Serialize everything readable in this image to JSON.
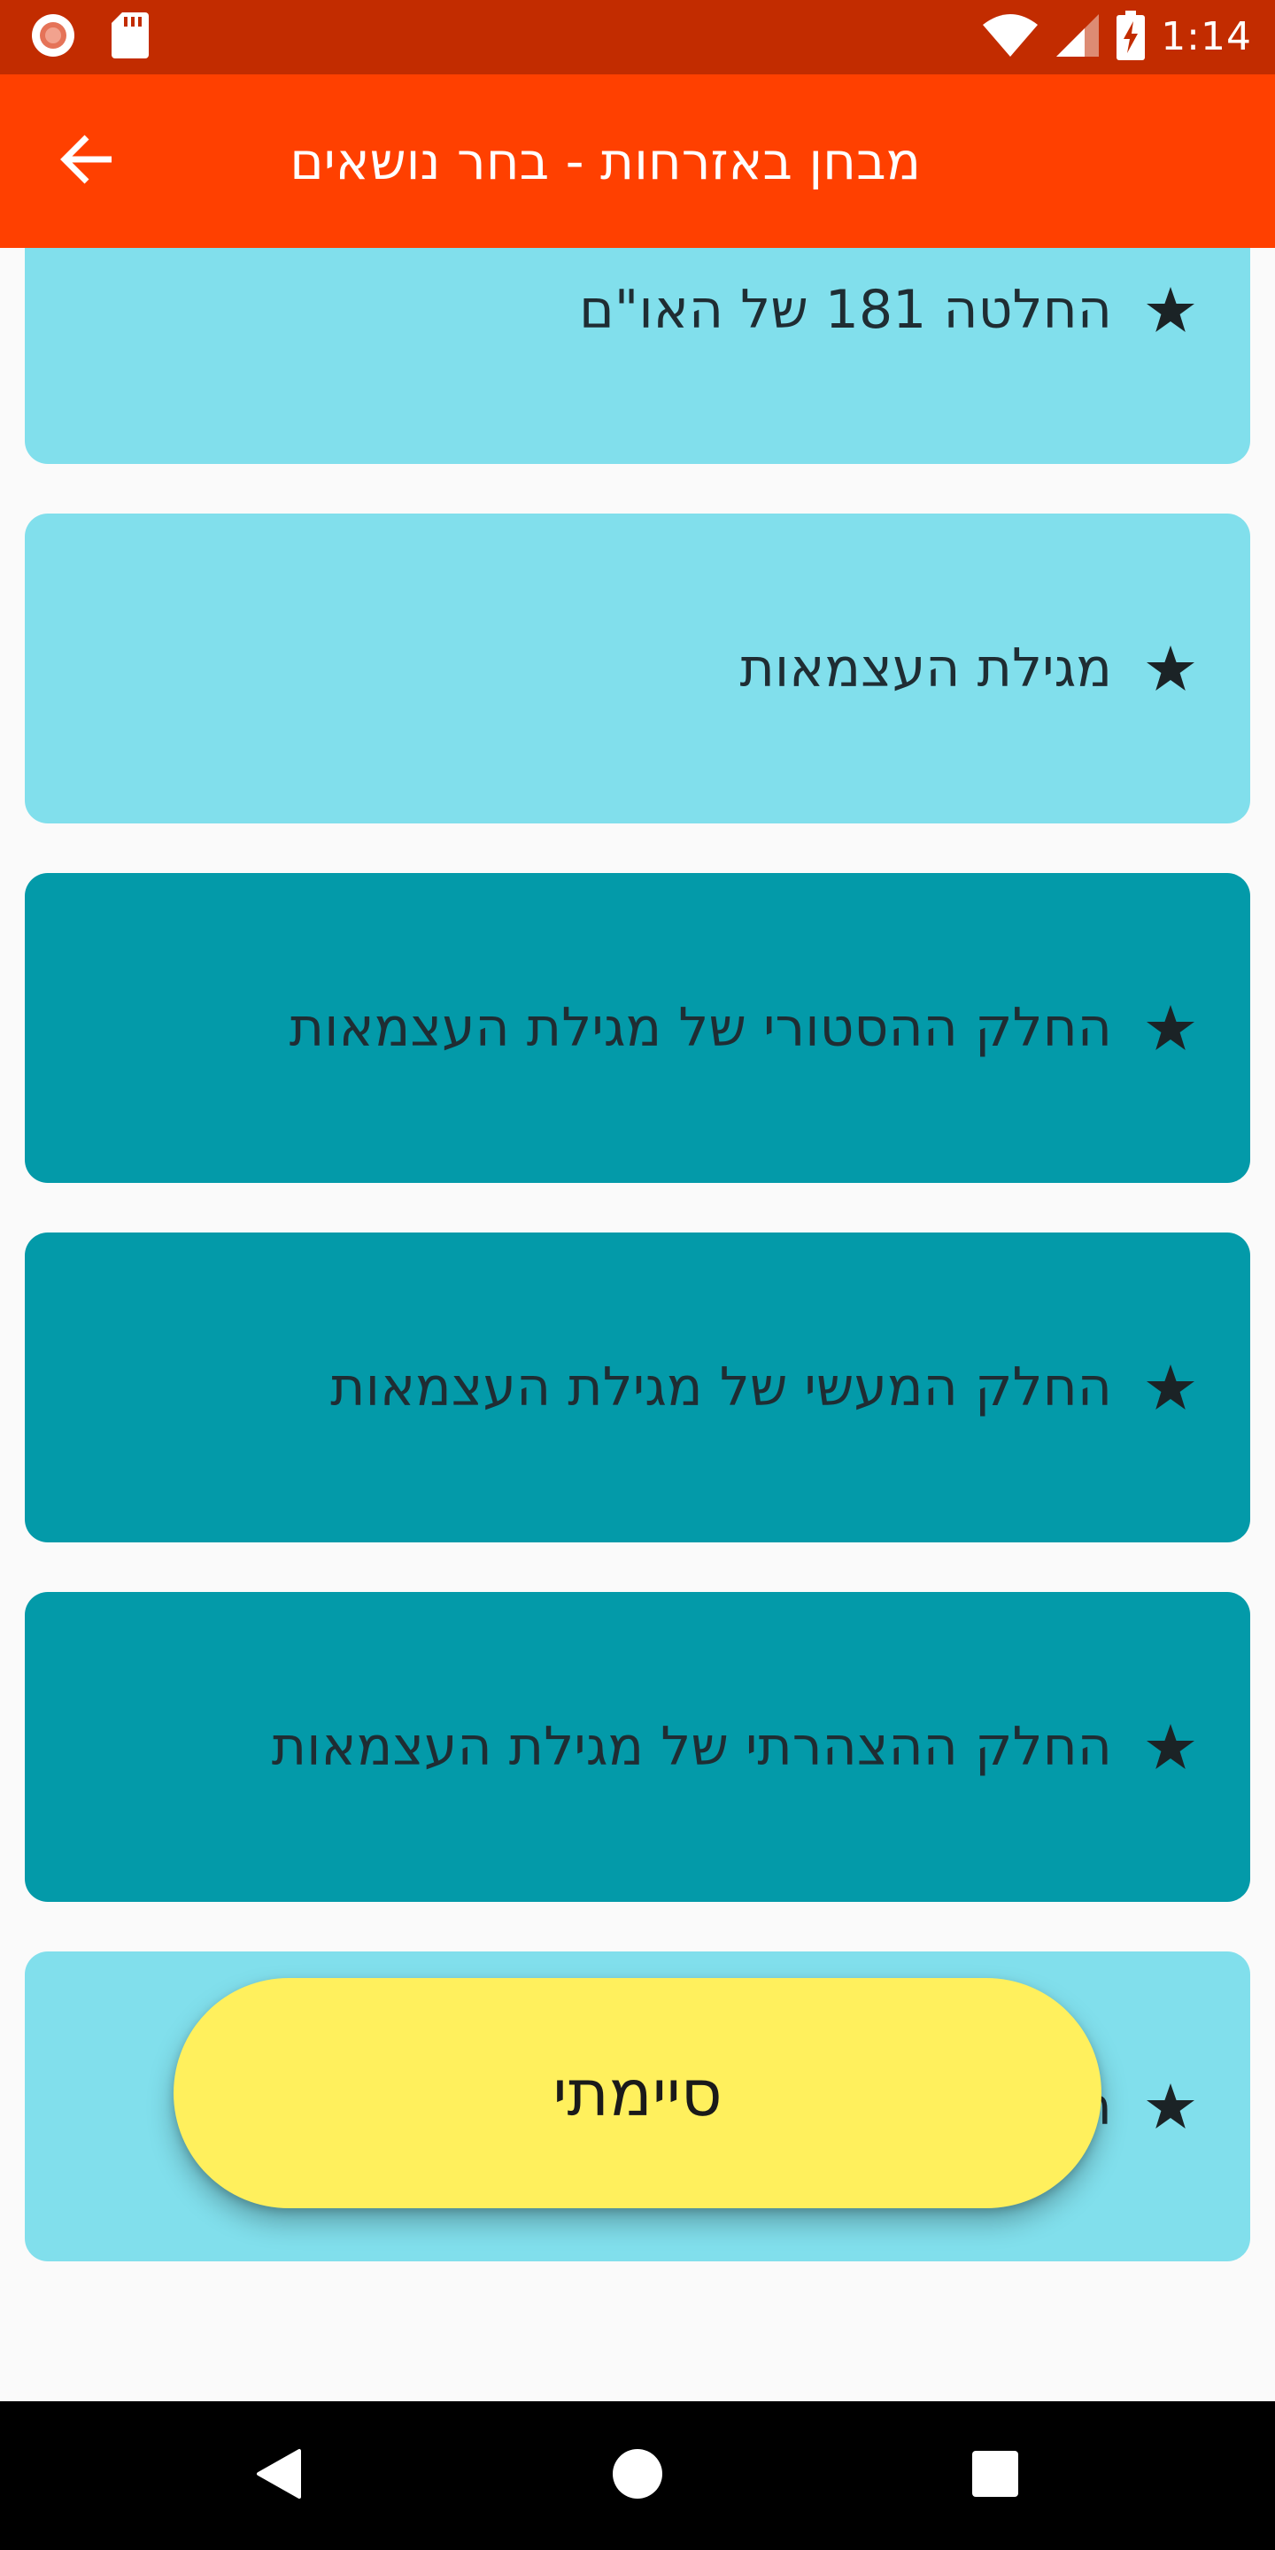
{
  "status_bar": {
    "time": "1:14",
    "left_icons": [
      "record-icon",
      "sd-card-icon"
    ],
    "right_icons": [
      "wifi-icon",
      "signal-icon",
      "battery-charging-icon"
    ]
  },
  "app_bar": {
    "title": "מבחן באזרחות - בחר נושאים",
    "back_icon": "arrow-back-icon",
    "background": "#ff4000"
  },
  "topics": [
    {
      "label": "החלטה 181 של האו\"ם",
      "selected": false
    },
    {
      "label": "מגילת העצמאות",
      "selected": false
    },
    {
      "label": "החלק ההסטורי של מגילת העצמאות",
      "selected": true
    },
    {
      "label": "החלק המעשי של מגילת העצמאות",
      "selected": true
    },
    {
      "label": "החלק ההצהרתי של מגילת העצמאות",
      "selected": true
    },
    {
      "label": "ה",
      "selected": false
    }
  ],
  "colors": {
    "card_unselected": "#81dfec",
    "card_selected": "#039aa9",
    "done_button": "#fff05d",
    "status_bar": "#c22c00"
  },
  "done_button": {
    "label": "סיימתי"
  },
  "nav_bar": {
    "buttons": [
      "back-triangle-icon",
      "home-circle-icon",
      "recents-square-icon"
    ]
  }
}
